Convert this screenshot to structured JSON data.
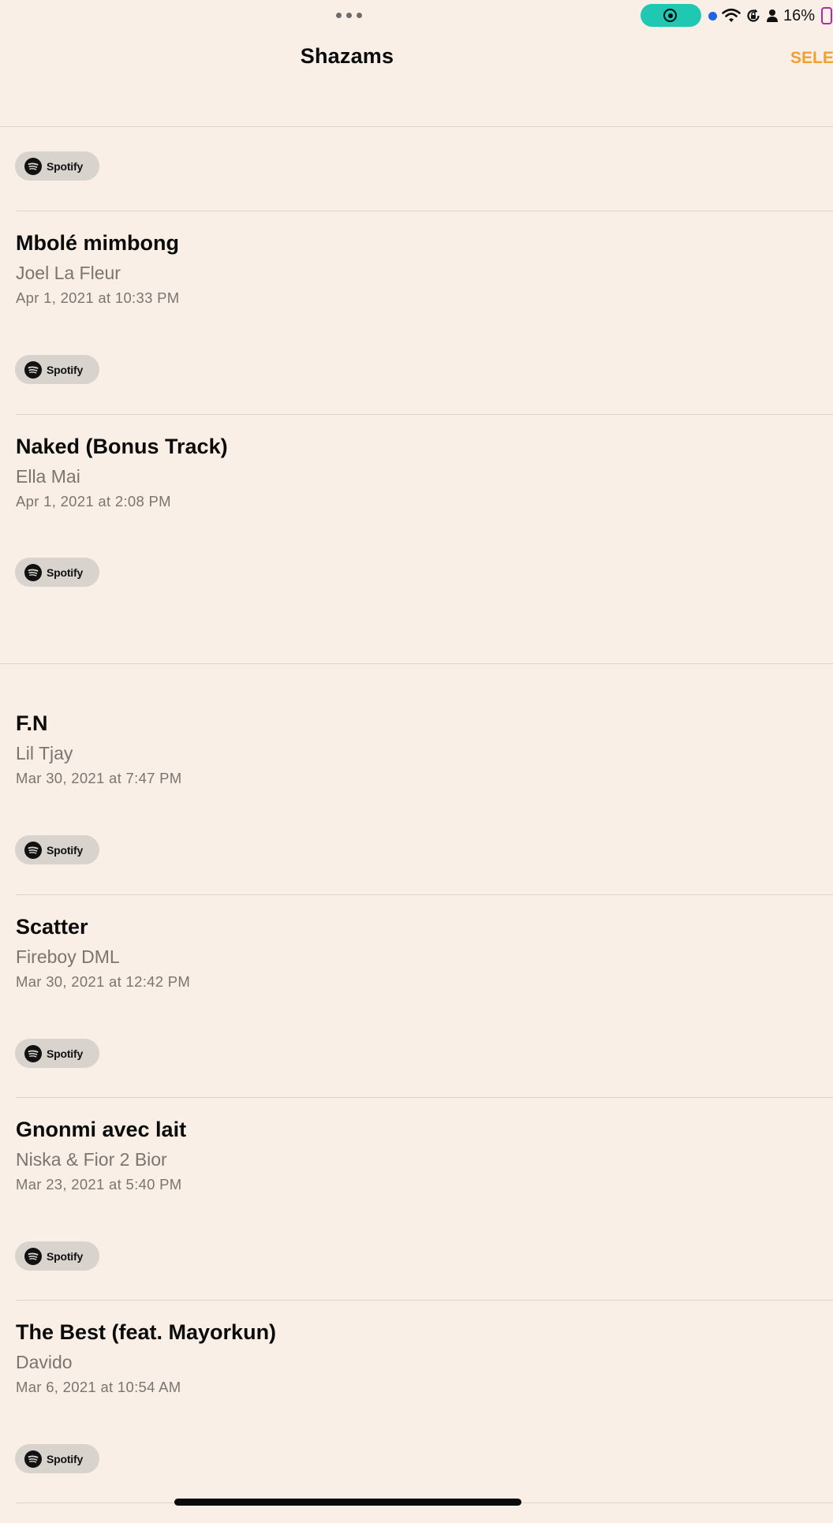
{
  "status_bar": {
    "battery_percent": "16%",
    "recording_color": "#1fc8b3",
    "location_dot_color": "#1c63e6",
    "battery_color": "#b02aa5"
  },
  "nav": {
    "title": "Shazams",
    "select_label": "SELE",
    "accent_color": "#f0a030"
  },
  "spotify_label": "Spotify",
  "songs": [
    {
      "title": "Mbolé mimbong",
      "artist": "Joel La Fleur",
      "date": "Apr 1, 2021 at 10:33 PM"
    },
    {
      "title": "Naked (Bonus Track)",
      "artist": "Ella Mai",
      "date": "Apr 1, 2021 at 2:08 PM"
    },
    {
      "title": "F.N",
      "artist": "Lil Tjay",
      "date": "Mar 30, 2021 at 7:47 PM"
    },
    {
      "title": "Scatter",
      "artist": "Fireboy DML",
      "date": "Mar 30, 2021 at 12:42 PM"
    },
    {
      "title": "Gnonmi avec lait",
      "artist": "Niska & Fior 2 Bior",
      "date": "Mar 23, 2021 at 5:40 PM"
    },
    {
      "title": "The Best (feat. Mayorkun)",
      "artist": "Davido",
      "date": "Mar 6, 2021 at 10:54 AM"
    }
  ]
}
